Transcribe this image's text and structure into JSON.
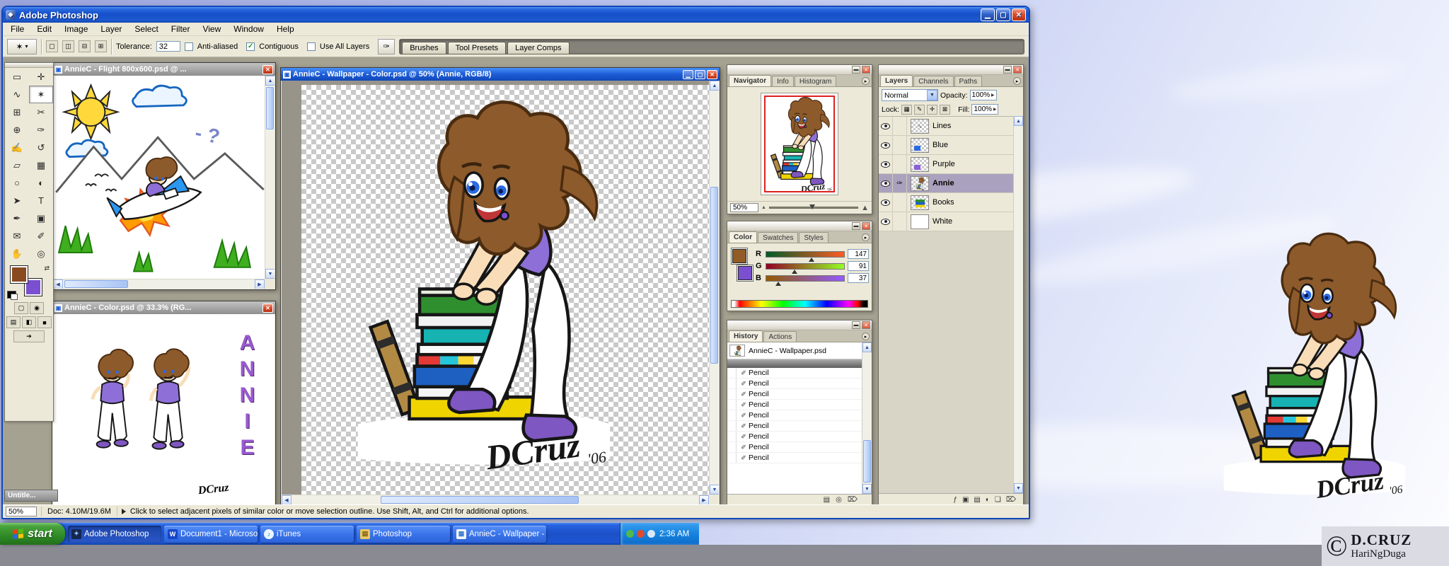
{
  "app": {
    "title": "Adobe Photoshop",
    "menu_items": [
      "File",
      "Edit",
      "Image",
      "Layer",
      "Select",
      "Filter",
      "View",
      "Window",
      "Help"
    ],
    "window_controls": {
      "minimize": "▁",
      "maximize": "▢",
      "close": "✕"
    }
  },
  "options_bar": {
    "tool_glyph": "✶",
    "dropdown_arrow": "▾",
    "selection_modes": [
      {
        "name": "new-selection",
        "glyph": "▢"
      },
      {
        "name": "add-to-selection",
        "glyph": "◫"
      },
      {
        "name": "subtract-from-selection",
        "glyph": "⊟"
      },
      {
        "name": "intersect-selection",
        "glyph": "⊞"
      }
    ],
    "tolerance_label": "Tolerance:",
    "tolerance_value": "32",
    "anti_aliased_label": "Anti-aliased",
    "contiguous_label": "Contiguous",
    "use_all_layers_label": "Use All Layers",
    "check_glyph": "✓",
    "file_browser_glyph": "✑",
    "palette_well_tabs": [
      "Brushes",
      "Tool Presets",
      "Layer Comps"
    ]
  },
  "toolbox": {
    "tools": [
      {
        "name": "rectangular-marquee",
        "glyph": "▭"
      },
      {
        "name": "move",
        "glyph": "✛"
      },
      {
        "name": "lasso",
        "glyph": "∿"
      },
      {
        "name": "magic-wand",
        "glyph": "✶"
      },
      {
        "name": "crop",
        "glyph": "⊞"
      },
      {
        "name": "slice",
        "glyph": "✂"
      },
      {
        "name": "healing-brush",
        "glyph": "⊕"
      },
      {
        "name": "brush",
        "glyph": "✑"
      },
      {
        "name": "clone-stamp",
        "glyph": "✍"
      },
      {
        "name": "history-brush",
        "glyph": "↺"
      },
      {
        "name": "eraser",
        "glyph": "▱"
      },
      {
        "name": "gradient",
        "glyph": "▦"
      },
      {
        "name": "blur",
        "glyph": "○"
      },
      {
        "name": "dodge",
        "glyph": "◐"
      },
      {
        "name": "path-selection",
        "glyph": "➤"
      },
      {
        "name": "type",
        "glyph": "T"
      },
      {
        "name": "pen",
        "glyph": "✒"
      },
      {
        "name": "shape",
        "glyph": "▣"
      },
      {
        "name": "notes",
        "glyph": "✉"
      },
      {
        "name": "eyedropper",
        "glyph": "✐"
      },
      {
        "name": "hand",
        "glyph": "✋"
      },
      {
        "name": "zoom",
        "glyph": "◎"
      }
    ],
    "foreground_color": "#8a4a20",
    "background_color": "#7a4fd0",
    "swap_glyph": "⇄",
    "mask_modes": [
      {
        "name": "standard-mode",
        "glyph": "▢"
      },
      {
        "name": "quick-mask-mode",
        "glyph": "◉"
      }
    ],
    "screen_modes": [
      {
        "name": "standard-screen-mode",
        "glyph": "▤"
      },
      {
        "name": "fullscreen-with-menubar",
        "glyph": "◧"
      },
      {
        "name": "fullscreen-mode",
        "glyph": "■"
      }
    ],
    "imageready_glyph": "➔"
  },
  "documents": {
    "flight": {
      "title": "AnnieC - Flight 800x600.psd @ ...",
      "annotation": "- ?"
    },
    "wallpaper": {
      "title": "AnnieC - Wallpaper - Color.psd @ 50% (Annie, RGB/8)",
      "signature": "DCruz",
      "signature_year": "'06"
    },
    "color": {
      "title": "AnnieC - Color.psd @ 33.3% (RG...",
      "vertical_text": "ANNIE"
    },
    "untitled": {
      "title": "Untitle..."
    }
  },
  "palettes": {
    "navigator": {
      "tabs": [
        "Navigator",
        "Info",
        "Histogram"
      ],
      "zoom_value": "50%"
    },
    "color": {
      "tabs": [
        "Color",
        "Swatches",
        "Styles"
      ],
      "foreground_swatch": "#935b25",
      "background_swatch": "#7a4fd0",
      "channels": [
        {
          "label": "R",
          "value": "147",
          "pos": 58
        },
        {
          "label": "G",
          "value": "91",
          "pos": 36
        },
        {
          "label": "B",
          "value": "37",
          "pos": 15
        }
      ]
    },
    "history": {
      "tabs": [
        "History",
        "Actions"
      ],
      "snapshot_name": "AnnieC - Wallpaper.psd",
      "state_icon": "✐",
      "states": [
        "Pencil",
        "Pencil",
        "Pencil",
        "Pencil",
        "Pencil",
        "Pencil",
        "Pencil",
        "Pencil",
        "Pencil"
      ],
      "foot_icons": [
        {
          "name": "new-document-from-state",
          "glyph": "▤"
        },
        {
          "name": "new-snapshot",
          "glyph": "◎"
        },
        {
          "name": "delete-state",
          "glyph": "⌦"
        }
      ]
    },
    "layers": {
      "tabs": [
        "Layers",
        "Channels",
        "Paths"
      ],
      "blend_mode": "Normal",
      "opacity_label": "Opacity:",
      "opacity_value": "100%",
      "lock_label": "Lock:",
      "lock_icons": [
        {
          "name": "lock-transparency",
          "glyph": "▦"
        },
        {
          "name": "lock-image",
          "glyph": "✎"
        },
        {
          "name": "lock-position",
          "glyph": "✛"
        },
        {
          "name": "lock-all",
          "glyph": "⊠"
        }
      ],
      "fill_label": "Fill:",
      "fill_value": "100%",
      "items": [
        {
          "name": "Lines"
        },
        {
          "name": "Blue"
        },
        {
          "name": "Purple"
        },
        {
          "name": "Annie",
          "selected": true,
          "edit_glyph": "✑"
        },
        {
          "name": "Books"
        },
        {
          "name": "White"
        }
      ],
      "foot_icons": [
        {
          "name": "layer-style",
          "glyph": "ƒ"
        },
        {
          "name": "layer-mask",
          "glyph": "▣"
        },
        {
          "name": "layer-set",
          "glyph": "▤"
        },
        {
          "name": "adjustment-layer",
          "glyph": "◐"
        },
        {
          "name": "new-layer",
          "glyph": "❏"
        },
        {
          "name": "delete-layer",
          "glyph": "⌦"
        }
      ]
    }
  },
  "status_bar": {
    "zoom": "50%",
    "doc_size": "Doc: 4.10M/19.6M",
    "hint": "Click to select adjacent pixels of similar color or move selection outline. Use Shift, Alt, and Ctrl for additional options."
  },
  "taskbar": {
    "start_label": "start",
    "buttons": [
      {
        "label": "Adobe Photoshop",
        "icon": "✦",
        "active": true
      },
      {
        "label": "Document1 - Microso...",
        "icon": "W"
      },
      {
        "label": "iTunes",
        "icon": "♪"
      },
      {
        "label": "Photoshop",
        "icon": "▤"
      },
      {
        "label": "AnnieC - Wallpaper - ...",
        "icon": "▦"
      }
    ],
    "clock": "2:36 AM"
  },
  "desktop": {
    "copyright_symbol": "©",
    "copyright_name": "D.CRUZ",
    "copyright_sub": "HariNgDuga"
  }
}
